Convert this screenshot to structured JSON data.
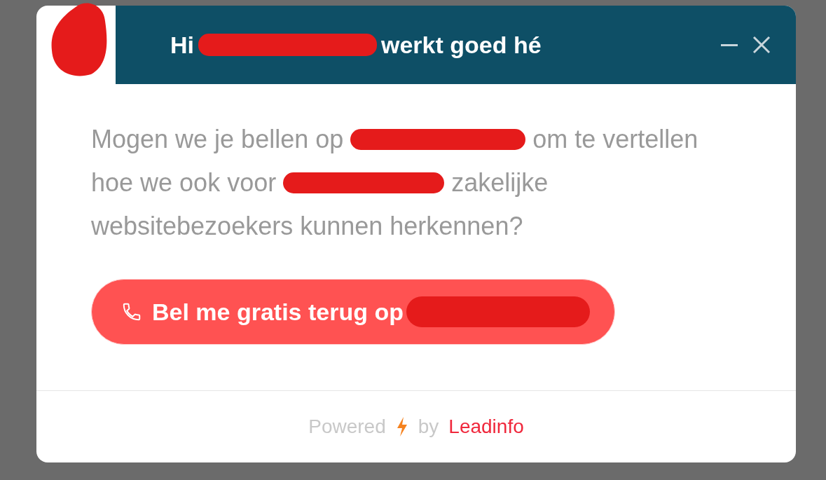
{
  "header": {
    "title": [
      {
        "kind": "text",
        "text": "Hi"
      },
      {
        "kind": "redaction"
      },
      {
        "kind": "text",
        "text": "werkt goed hé"
      }
    ],
    "controls": [
      {
        "kind": "minimize"
      },
      {
        "kind": "close"
      }
    ]
  },
  "message": [
    [
      {
        "kind": "text",
        "text": "Mogen we je bellen op"
      },
      {
        "kind": "redaction"
      },
      {
        "kind": "text",
        "text": "om te vertellen"
      }
    ],
    [
      {
        "kind": "text",
        "text": "hoe we ook voor"
      },
      {
        "kind": "redaction"
      },
      {
        "kind": "text",
        "text": "zakelijke"
      }
    ],
    [
      {
        "kind": "text",
        "text": "websitebezoekers kunnen herkennen?"
      }
    ]
  ],
  "call_button": [
    {
      "kind": "text",
      "text": "Bel me gratis terug op"
    },
    {
      "kind": "redaction"
    }
  ],
  "footer": {
    "powered": "Powered",
    "by": "by",
    "brand": "Leadinfo"
  }
}
